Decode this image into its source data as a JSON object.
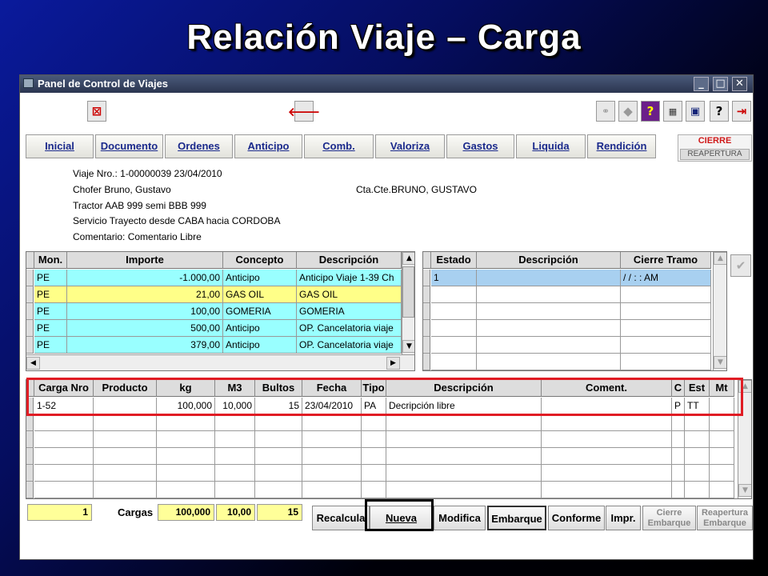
{
  "slide": {
    "title": "Relación Viaje – Carga"
  },
  "window": {
    "title": "Panel de Control de Viajes"
  },
  "tabs": [
    "Inicial",
    "Documento",
    "Ordenes",
    "Anticipo",
    "Comb.",
    "Valoriza",
    "Gastos",
    "Liquida",
    "Rendición"
  ],
  "cierre": {
    "label": "CIERRE",
    "reapertura": "REAPERTURA"
  },
  "info": {
    "viaje": "Viaje Nro.: 1-00000039 23/04/2010",
    "chofer": "Chofer Bruno, Gustavo",
    "tractor": "Tractor AAB 999   semi BBB 999",
    "servicio": "Servicio  Trayecto  desde CABA hacia CORDOBA",
    "comentario": "Comentario: Comentario Libre",
    "ctacte": "Cta.Cte.BRUNO, GUSTAVO"
  },
  "left_grid": {
    "headers": [
      "Mon.",
      "Importe",
      "Concepto",
      "Descripción"
    ],
    "rows": [
      {
        "mon": "PE",
        "importe": "-1.000,00",
        "concepto": "Anticipo",
        "desc": "Anticipo Viaje 1-39 Ch",
        "color": "#99ffff"
      },
      {
        "mon": "PE",
        "importe": "21,00",
        "concepto": "GAS OIL",
        "desc": "GAS OIL",
        "color": "#ffff88"
      },
      {
        "mon": "PE",
        "importe": "100,00",
        "concepto": "GOMERIA",
        "desc": "GOMERIA",
        "color": "#99ffff"
      },
      {
        "mon": "PE",
        "importe": "500,00",
        "concepto": "Anticipo",
        "desc": "OP. Cancelatoria viaje",
        "color": "#99ffff"
      },
      {
        "mon": "PE",
        "importe": "379,00",
        "concepto": "Anticipo",
        "desc": "OP. Cancelatoria viaje",
        "color": "#99ffff"
      }
    ]
  },
  "right_grid": {
    "headers": [
      "Estado",
      "Descripción",
      "Cierre Tramo"
    ],
    "rows": [
      {
        "estado": "1",
        "desc": "",
        "cierre": "/ /      :  :  AM"
      }
    ]
  },
  "bottom_grid": {
    "headers": [
      "Carga Nro",
      "Producto",
      "kg",
      "M3",
      "Bultos",
      "Fecha",
      "Tipo",
      "Descripción",
      "Coment.",
      "C",
      "Est",
      "Mt"
    ],
    "rows": [
      [
        "1-52",
        "",
        "100,000",
        "10,000",
        "15",
        "23/04/2010",
        "PA",
        "Decripción libre",
        "",
        "P",
        "TT",
        ""
      ]
    ]
  },
  "footer": {
    "count": "1",
    "cargas_label": "Cargas",
    "kg": "100,000",
    "m3": "10,00",
    "bultos": "15"
  },
  "buttons": {
    "recalcula": "Recalcula",
    "nueva": "Nueva",
    "modifica": "Modifica",
    "embarque": "Embarque",
    "conforme": "Conforme",
    "impr": "Impr.",
    "cierre_embarque_1": "Cierre",
    "cierre_embarque_2": "Embarque",
    "reapertura_embarque_1": "Reapertura",
    "reapertura_embarque_2": "Embarque"
  },
  "colors": {
    "cyan_row": "#99ffff",
    "yellow_row": "#ffff88",
    "highlight_red": "#e01c24",
    "tab_text": "#1b2a8c"
  }
}
